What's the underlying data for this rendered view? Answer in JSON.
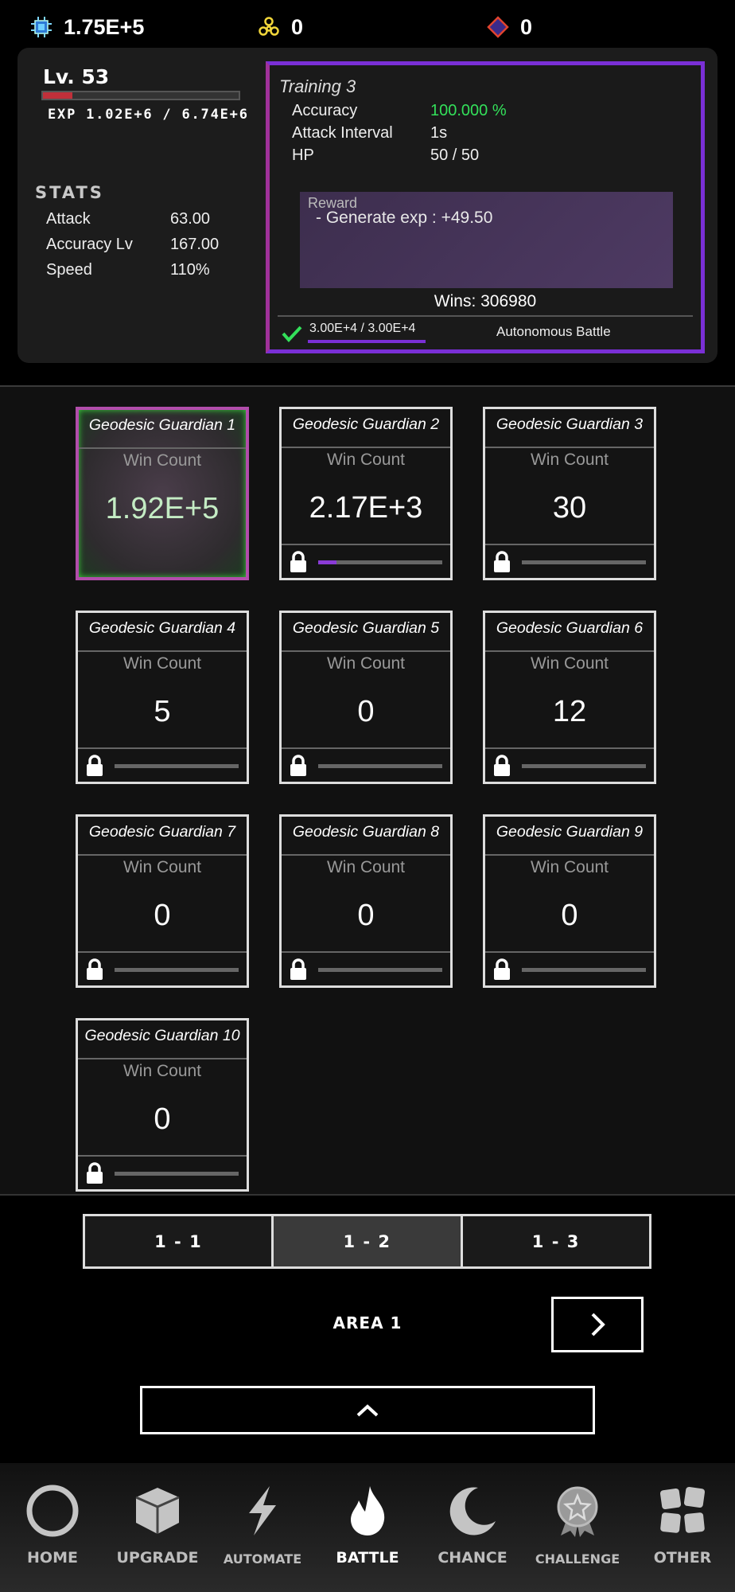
{
  "resources": {
    "chip": "1.75E+5",
    "gems": "0",
    "diamond": "0"
  },
  "player": {
    "level": "Lv. 53",
    "exp_progress": 0.15,
    "exp_text": "EXP 1.02E+6 / 6.74E+6"
  },
  "stats": {
    "heading": "STATS",
    "rows": [
      {
        "label": "Attack",
        "value": "63.00"
      },
      {
        "label": "Accuracy Lv",
        "value": "167.00"
      },
      {
        "label": "Speed",
        "value": "110%"
      }
    ]
  },
  "training": {
    "title": "Training 3",
    "rows": [
      {
        "label": "Accuracy",
        "value": "100.000 %"
      },
      {
        "label": "Attack Interval",
        "value": "1s"
      },
      {
        "label": "HP",
        "value": "50 / 50"
      }
    ],
    "reward_label": "Reward",
    "reward_value": "- Generate exp : +49.50",
    "wins": "Wins: 306980",
    "progress_text": "3.00E+4 / 3.00E+4",
    "progress": 1.0,
    "autonomous": "Autonomous Battle"
  },
  "guardians": [
    {
      "name": "Geodesic Guardian 1",
      "label": "Win Count",
      "value": "1.92E+5",
      "selected": true,
      "progress": 0
    },
    {
      "name": "Geodesic Guardian 2",
      "label": "Win Count",
      "value": "2.17E+3",
      "progress": 0.15
    },
    {
      "name": "Geodesic Guardian 3",
      "label": "Win Count",
      "value": "30",
      "progress": 0
    },
    {
      "name": "Geodesic Guardian 4",
      "label": "Win Count",
      "value": "5",
      "progress": 0
    },
    {
      "name": "Geodesic Guardian 5",
      "label": "Win Count",
      "value": "0",
      "progress": 0
    },
    {
      "name": "Geodesic Guardian 6",
      "label": "Win Count",
      "value": "12",
      "progress": 0
    },
    {
      "name": "Geodesic Guardian 7",
      "label": "Win Count",
      "value": "0",
      "progress": 0
    },
    {
      "name": "Geodesic Guardian 8",
      "label": "Win Count",
      "value": "0",
      "progress": 0
    },
    {
      "name": "Geodesic Guardian 9",
      "label": "Win Count",
      "value": "0",
      "progress": 0
    },
    {
      "name": "Geodesic Guardian 10",
      "label": "Win Count",
      "value": "0",
      "progress": 0
    }
  ],
  "subtabs": [
    "1 - 1",
    "1 - 2",
    "1 - 3"
  ],
  "active_subtab": 1,
  "area": "AREA 1",
  "nav": [
    {
      "label": "HOME",
      "icon": "home-ring-icon"
    },
    {
      "label": "UPGRADE",
      "icon": "cube-icon"
    },
    {
      "label": "AUTOMATE",
      "icon": "lightning-icon"
    },
    {
      "label": "BATTLE",
      "icon": "flame-icon"
    },
    {
      "label": "CHANCE",
      "icon": "moon-icon"
    },
    {
      "label": "CHALLENGE",
      "icon": "medal-icon"
    },
    {
      "label": "OTHER",
      "icon": "grid-icon"
    }
  ],
  "colors": {
    "accent_purple": "#7a2fd6",
    "accent_green": "#33e05a",
    "exp_red": "#c0303a"
  }
}
